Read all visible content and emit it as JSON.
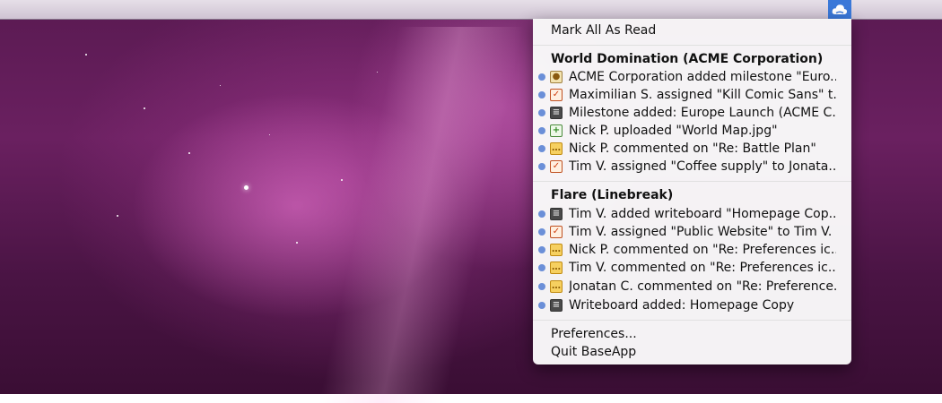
{
  "menu": {
    "mark_all_read": "Mark All As Read",
    "preferences": "Preferences...",
    "quit": "Quit BaseApp"
  },
  "groups": [
    {
      "title": "World Domination (ACME Corporation)",
      "items": [
        {
          "icon": "milestone-icon",
          "text": "ACME Corporation added milestone \"Euro..."
        },
        {
          "icon": "todo-check-icon",
          "text": "Maximilian S. assigned \"Kill Comic Sans\" t..."
        },
        {
          "icon": "writeboard-icon",
          "text": "Milestone added: Europe Launch (ACME C..."
        },
        {
          "icon": "file-upload-icon",
          "text": "Nick P. uploaded \"World Map.jpg\""
        },
        {
          "icon": "comment-icon",
          "text": "Nick P. commented on \"Re: Battle Plan\""
        },
        {
          "icon": "todo-check-icon",
          "text": "Tim V. assigned \"Coffee supply\" to Jonata..."
        }
      ]
    },
    {
      "title": "Flare (Linebreak)",
      "items": [
        {
          "icon": "writeboard-icon",
          "text": "Tim V. added writeboard \"Homepage Cop..."
        },
        {
          "icon": "todo-check-icon",
          "text": "Tim V. assigned \"Public Website\" to Tim V."
        },
        {
          "icon": "comment-icon",
          "text": "Nick P. commented on \"Re: Preferences ic..."
        },
        {
          "icon": "comment-icon",
          "text": "Tim V. commented on \"Re: Preferences ic..."
        },
        {
          "icon": "comment-icon",
          "text": "Jonatan C. commented on \"Re: Preference..."
        },
        {
          "icon": "writeboard-icon",
          "text": "Writeboard added: Homepage Copy"
        }
      ]
    }
  ],
  "colors": {
    "unread_dot": "#6b8fd8",
    "status_item_bg": "#3a78d8"
  }
}
